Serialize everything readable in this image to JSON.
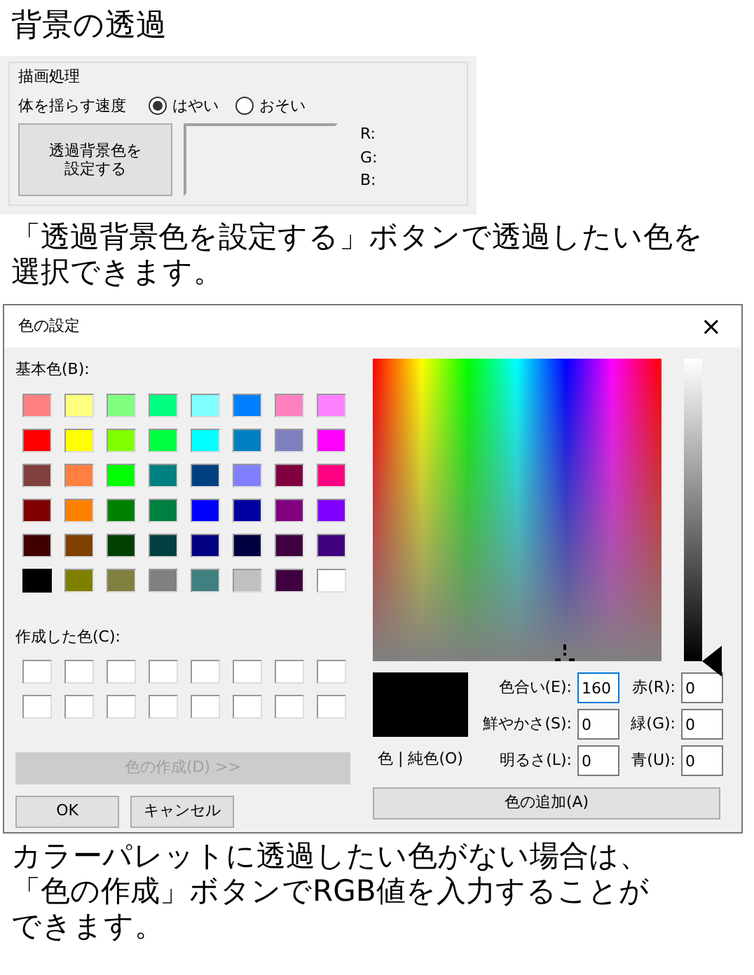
{
  "heading": "背景の透過",
  "settings_panel": {
    "group_title": "描画処理",
    "speed_label": "体を揺らす速度",
    "speed_options": [
      {
        "label": "はやい",
        "selected": true
      },
      {
        "label": "おそい",
        "selected": false
      }
    ],
    "set_color_button": "透過背景色を設定する",
    "rgb_labels": [
      "R:",
      "G:",
      "B:"
    ]
  },
  "caption": "「透過背景色を設定する」ボタンで透過したい色を選択できます。",
  "dialog": {
    "title": "色の設定",
    "close": "×",
    "basic_colors_label": "基本色(B):",
    "basic_colors": [
      {
        "color": "#ff8080",
        "selected": false
      },
      {
        "color": "#ffff80",
        "selected": false
      },
      {
        "color": "#80ff80",
        "selected": false
      },
      {
        "color": "#00ff80",
        "selected": false
      },
      {
        "color": "#80ffff",
        "selected": false
      },
      {
        "color": "#0080ff",
        "selected": false
      },
      {
        "color": "#ff80c0",
        "selected": false
      },
      {
        "color": "#ff80ff",
        "selected": false
      },
      {
        "color": "#ff0000",
        "selected": false
      },
      {
        "color": "#ffff00",
        "selected": false
      },
      {
        "color": "#80ff00",
        "selected": false
      },
      {
        "color": "#00ff40",
        "selected": false
      },
      {
        "color": "#00ffff",
        "selected": false
      },
      {
        "color": "#0080c0",
        "selected": false
      },
      {
        "color": "#8080c0",
        "selected": false
      },
      {
        "color": "#ff00ff",
        "selected": false
      },
      {
        "color": "#804040",
        "selected": false
      },
      {
        "color": "#ff8040",
        "selected": false
      },
      {
        "color": "#00ff00",
        "selected": false
      },
      {
        "color": "#008080",
        "selected": false
      },
      {
        "color": "#004080",
        "selected": false
      },
      {
        "color": "#8080ff",
        "selected": false
      },
      {
        "color": "#800040",
        "selected": false
      },
      {
        "color": "#ff0080",
        "selected": false
      },
      {
        "color": "#800000",
        "selected": false
      },
      {
        "color": "#ff8000",
        "selected": false
      },
      {
        "color": "#008000",
        "selected": false
      },
      {
        "color": "#008040",
        "selected": false
      },
      {
        "color": "#0000ff",
        "selected": false
      },
      {
        "color": "#0000a0",
        "selected": false
      },
      {
        "color": "#800080",
        "selected": false
      },
      {
        "color": "#8000ff",
        "selected": false
      },
      {
        "color": "#400000",
        "selected": false
      },
      {
        "color": "#804000",
        "selected": false
      },
      {
        "color": "#004000",
        "selected": false
      },
      {
        "color": "#004040",
        "selected": false
      },
      {
        "color": "#000080",
        "selected": false
      },
      {
        "color": "#000040",
        "selected": false
      },
      {
        "color": "#400040",
        "selected": false
      },
      {
        "color": "#400080",
        "selected": false
      },
      {
        "color": "#000000",
        "selected": true
      },
      {
        "color": "#808000",
        "selected": false
      },
      {
        "color": "#808040",
        "selected": false
      },
      {
        "color": "#808080",
        "selected": false
      },
      {
        "color": "#408080",
        "selected": false
      },
      {
        "color": "#c0c0c0",
        "selected": false
      },
      {
        "color": "#400040",
        "selected": false
      },
      {
        "color": "#ffffff",
        "selected": false
      }
    ],
    "custom_colors_label": "作成した色(C):",
    "custom_colors": [
      {
        "color": "#ffffff"
      },
      {
        "color": "#ffffff"
      },
      {
        "color": "#ffffff"
      },
      {
        "color": "#ffffff"
      },
      {
        "color": "#ffffff"
      },
      {
        "color": "#ffffff"
      },
      {
        "color": "#ffffff"
      },
      {
        "color": "#ffffff"
      },
      {
        "color": "#ffffff"
      },
      {
        "color": "#ffffff"
      },
      {
        "color": "#ffffff"
      },
      {
        "color": "#ffffff"
      },
      {
        "color": "#ffffff"
      },
      {
        "color": "#ffffff"
      },
      {
        "color": "#ffffff"
      },
      {
        "color": "#ffffff"
      }
    ],
    "define_button": {
      "label": "色の作成(D) >>",
      "disabled": true
    },
    "ok_button": "OK",
    "cancel_button": "キャンセル",
    "luminance_slider": {
      "level": 0
    },
    "preview_label": "色 | 純色(O)",
    "fields": [
      {
        "label": "色合い(E):",
        "value": "160",
        "focused": true
      },
      {
        "label": "赤(R):",
        "value": "0",
        "focused": false
      },
      {
        "label": "鮮やかさ(S):",
        "value": "0",
        "focused": false
      },
      {
        "label": "緑(G):",
        "value": "0",
        "focused": false
      },
      {
        "label": "明るさ(L):",
        "value": "0",
        "focused": false
      },
      {
        "label": "青(U):",
        "value": "0",
        "focused": false
      }
    ],
    "add_button": "色の追加(A)"
  },
  "footer": "カラーパレットに透過したい色がない場合は、「色の作成」ボタンでRGB値を入力することができます。"
}
